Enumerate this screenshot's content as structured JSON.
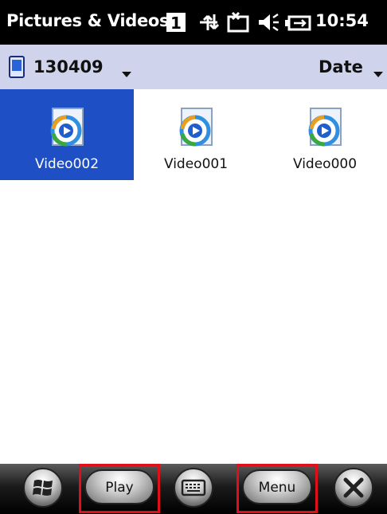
{
  "app": {
    "title": "Pictures & Videos",
    "clock": "10:54"
  },
  "status_icons": [
    "notification-count-icon",
    "connectivity-icon",
    "message-icon",
    "speaker-icon",
    "battery-icon"
  ],
  "toolbar": {
    "folder_label": "130409",
    "folder_icon": "storage-card-icon",
    "sort_label": "Date"
  },
  "items": [
    {
      "label": "Video002",
      "selected": true
    },
    {
      "label": "Video001",
      "selected": false
    },
    {
      "label": "Video000",
      "selected": false
    }
  ],
  "softkeys": {
    "left_label": "Play",
    "right_label": "Menu"
  },
  "colors": {
    "selection": "#1f4fc5",
    "toolbar_bg": "#cfd4ec",
    "highlight": "#e0101a"
  }
}
